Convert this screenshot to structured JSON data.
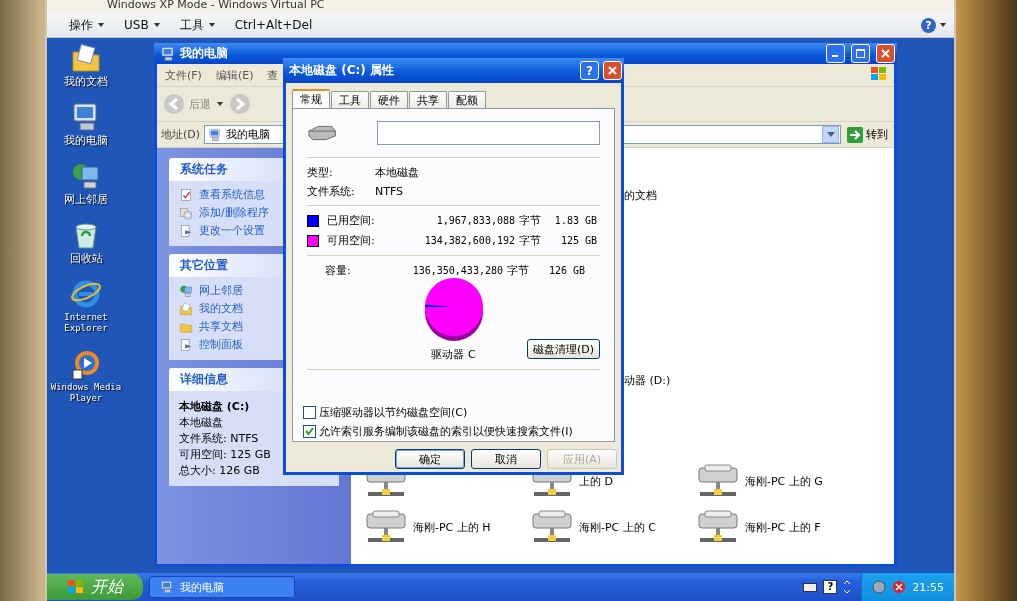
{
  "host_window": {
    "title": "Windows XP Mode - Windows Virtual PC",
    "menu": [
      {
        "label": "操作",
        "dropdown": true
      },
      {
        "label": "USB",
        "dropdown": true
      },
      {
        "label": "工具",
        "dropdown": true
      },
      {
        "label": "Ctrl+Alt+Del",
        "dropdown": false
      }
    ],
    "help_glyph": "?"
  },
  "desktop_icons": [
    {
      "label": "我的文档",
      "kind": "documents"
    },
    {
      "label": "我的电脑",
      "kind": "computer"
    },
    {
      "label": "网上邻居",
      "kind": "network"
    },
    {
      "label": "回收站",
      "kind": "recycle"
    },
    {
      "label": "Internet Explorer",
      "kind": "browser"
    },
    {
      "label": "Windows Media Player",
      "kind": "media"
    }
  ],
  "explorer": {
    "title": "我的电脑",
    "menu": [
      "文件(F)",
      "编辑(E)",
      "查"
    ],
    "back": "后退",
    "address": {
      "label": "地址(D)",
      "value": "我的电脑",
      "go": "转到"
    },
    "task_panels": [
      {
        "title": "系统任务",
        "items": [
          {
            "label": "查看系统信息",
            "kind": "info"
          },
          {
            "label": "添加/删除程序",
            "kind": "programs"
          },
          {
            "label": "更改一个设置",
            "kind": "settings"
          }
        ]
      },
      {
        "title": "其它位置",
        "items": [
          {
            "label": "网上邻居",
            "kind": "network"
          },
          {
            "label": "我的文档",
            "kind": "documents"
          },
          {
            "label": "共享文档",
            "kind": "folder"
          },
          {
            "label": "控制面板",
            "kind": "settings"
          }
        ]
      }
    ],
    "details": {
      "title": "详细信息",
      "name": "本地磁盘 (C:)",
      "lines": [
        "本地磁盘",
        "文件系统: NTFS",
        "可用空间: 125 GB",
        "总大小: 126 GB"
      ]
    },
    "fragments": [
      "的文档",
      "动器 (D:)"
    ],
    "network_drives": [
      {
        "kind": "network_drive"
      },
      {
        "kind": "network_drive",
        "label": "上的 D"
      },
      {
        "kind": "network_drive",
        "label": "海刚-PC 上的 G"
      },
      {
        "kind": "network_drive",
        "label": "海刚-PC 上的 H"
      },
      {
        "kind": "network_drive",
        "label": "海刚-PC 上的 C"
      },
      {
        "kind": "network_drive",
        "label": "海刚-PC 上的 F"
      }
    ]
  },
  "dialog": {
    "title": "本地磁盘 (C:) 属性",
    "help_glyph": "?",
    "tabs": [
      {
        "label": "常规",
        "selected": true
      },
      {
        "label": "工具",
        "selected": false
      },
      {
        "label": "硬件",
        "selected": false
      },
      {
        "label": "共享",
        "selected": false
      },
      {
        "label": "配额",
        "selected": false
      }
    ],
    "properties": [
      {
        "label": "类型:",
        "value": "本地磁盘"
      },
      {
        "label": "文件系统:",
        "value": "NTFS"
      }
    ],
    "space": [
      {
        "label": "已用空间:",
        "bytes": "1,967,833,088",
        "unit": "字节",
        "size": "1.83 GB",
        "color": "#0000ff"
      },
      {
        "label": "可用空间:",
        "bytes": "134,382,600,192",
        "unit": "字节",
        "size": "125 GB",
        "color": "#ff00ff"
      }
    ],
    "capacity": {
      "label": "容量:",
      "bytes": "136,350,433,280",
      "unit": "字节",
      "size": "126 GB"
    },
    "chart_data": {
      "type": "pie",
      "values": [
        1.44,
        98.56
      ]
    },
    "drive_label": "驱动器 C",
    "cleanup_button": "磁盘清理(D)",
    "options": [
      {
        "label": "压缩驱动器以节约磁盘空间(C)",
        "checked": false
      },
      {
        "label": "允许索引服务编制该磁盘的索引以便快速搜索文件(I)",
        "checked": true
      }
    ],
    "buttons": [
      {
        "label": "确定",
        "disabled": false
      },
      {
        "label": "取消",
        "disabled": false
      },
      {
        "label": "应用(A)",
        "disabled": true
      }
    ]
  },
  "taskbar": {
    "start": "开始",
    "tasks": [
      {
        "label": "我的电脑",
        "selected": false
      }
    ],
    "tray_help_glyph": "?",
    "clock": "21:55"
  }
}
